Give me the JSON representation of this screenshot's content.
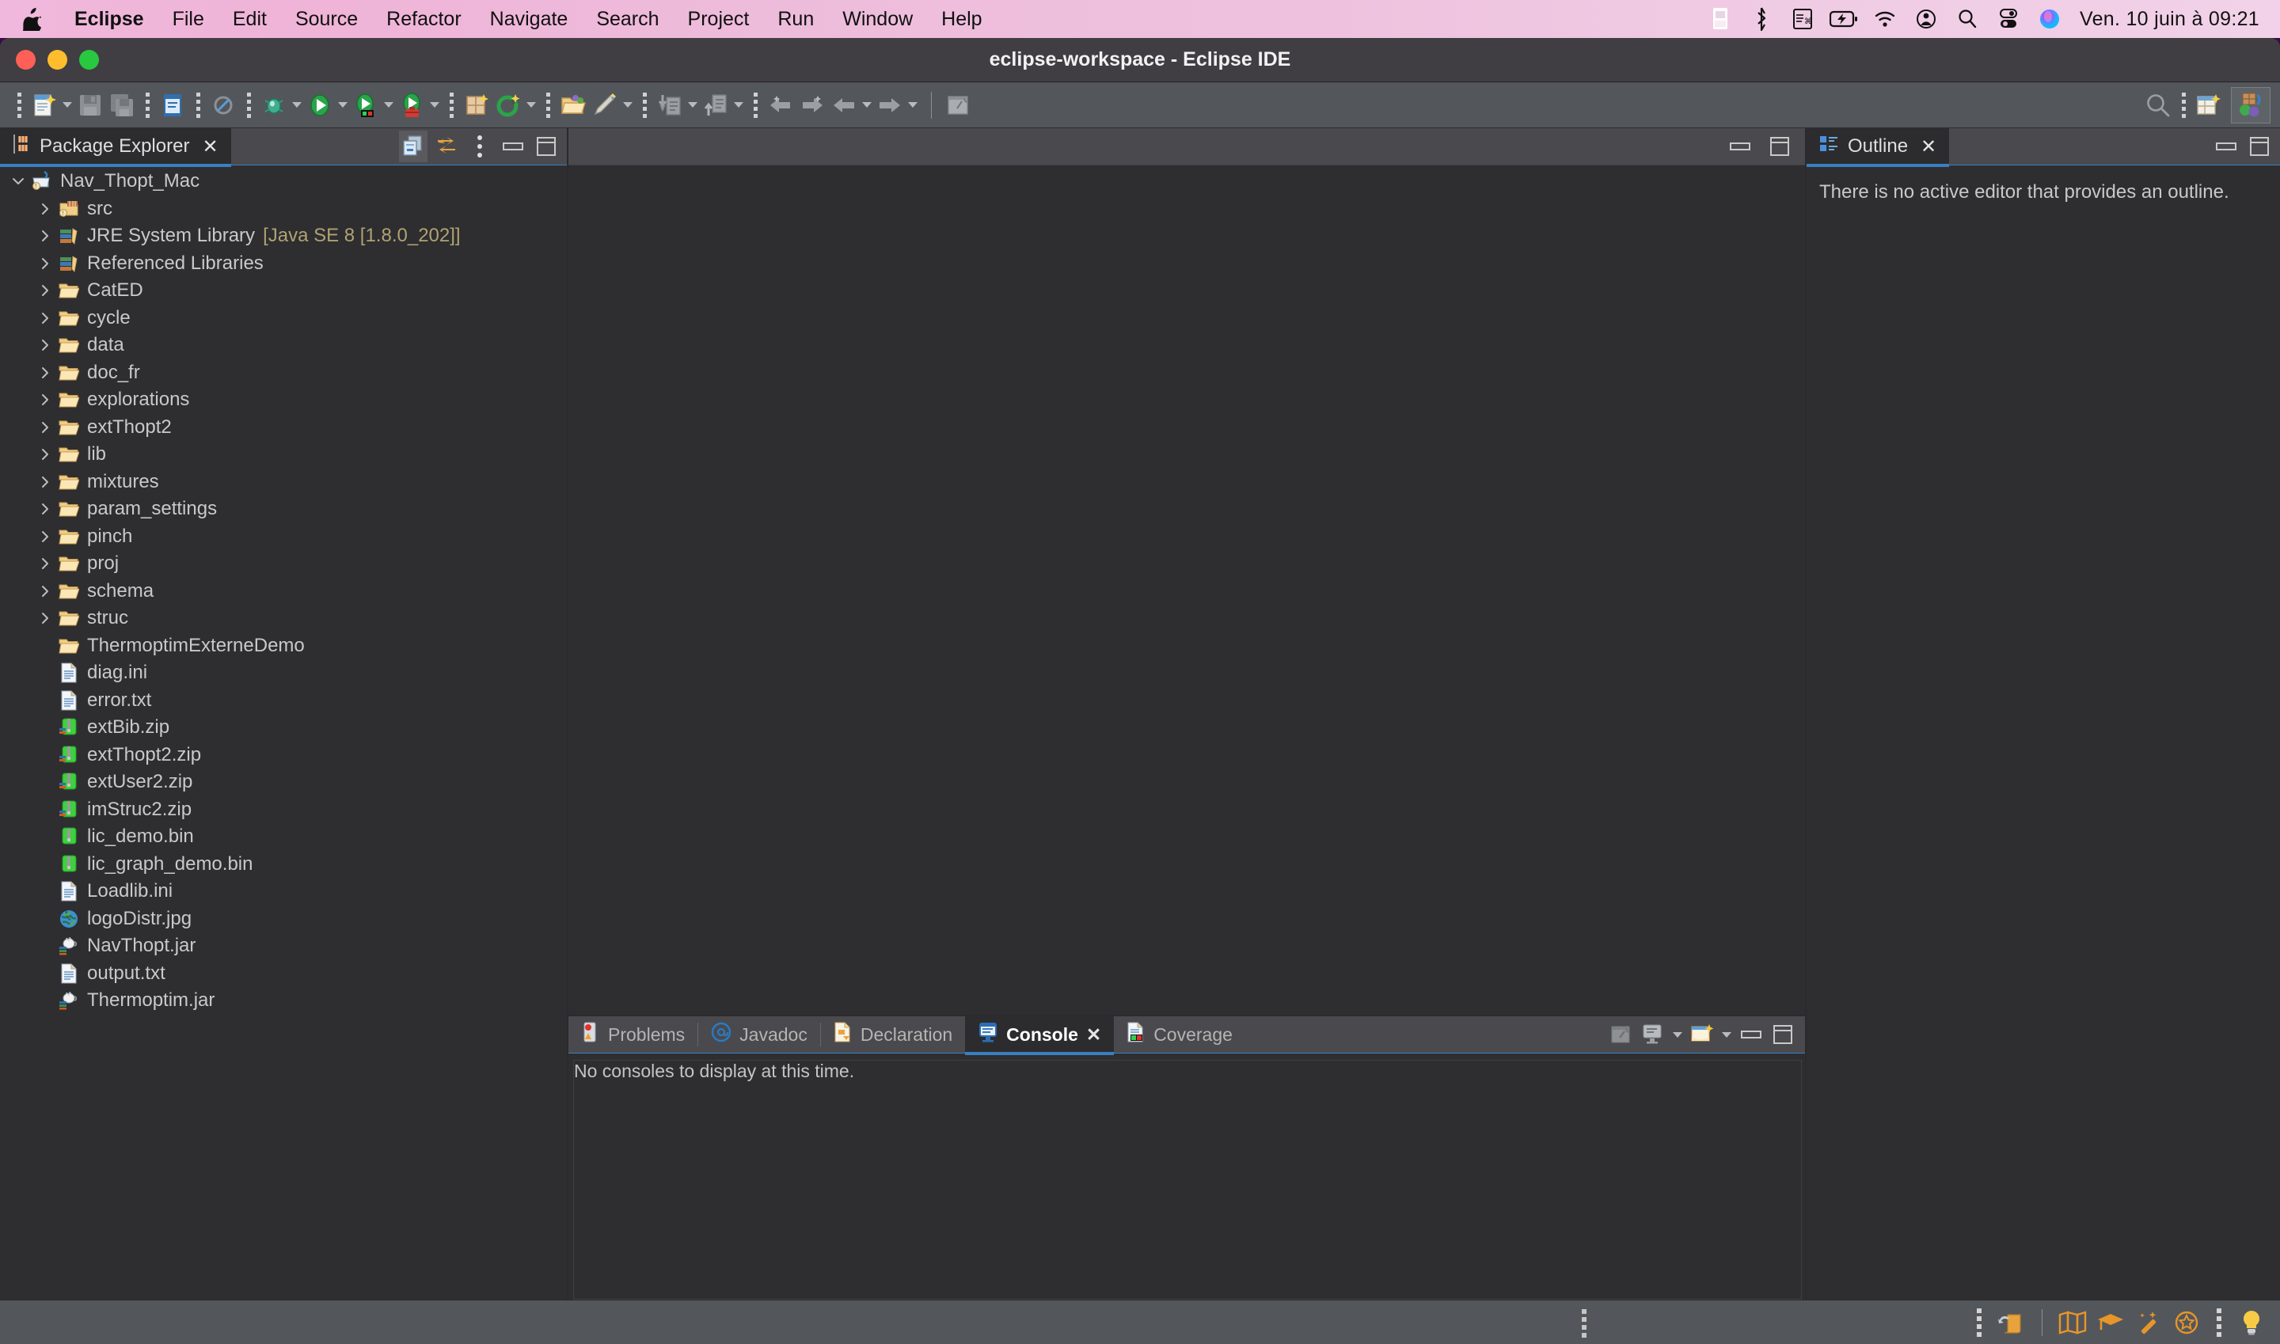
{
  "macbar": {
    "apple_icon": "apple-logo-icon",
    "menus": [
      {
        "label": "Eclipse",
        "bold": true
      },
      {
        "label": "File",
        "bold": false
      },
      {
        "label": "Edit",
        "bold": false
      },
      {
        "label": "Source",
        "bold": false
      },
      {
        "label": "Refactor",
        "bold": false
      },
      {
        "label": "Navigate",
        "bold": false
      },
      {
        "label": "Search",
        "bold": false
      },
      {
        "label": "Project",
        "bold": false
      },
      {
        "label": "Run",
        "bold": false
      },
      {
        "label": "Window",
        "bold": false
      },
      {
        "label": "Help",
        "bold": false
      }
    ],
    "status_icons": [
      "document-scanner-icon",
      "bluetooth-icon",
      "keyboard-input-icon",
      "battery-charging-icon",
      "wifi-icon",
      "user-account-icon",
      "spotlight-search-icon",
      "control-center-icon",
      "siri-icon"
    ],
    "clock": "Ven. 10 juin à  09:21"
  },
  "window": {
    "title": "eclipse-workspace - Eclipse IDE",
    "traffic_lights": [
      "close-button",
      "minimize-button",
      "zoom-button"
    ]
  },
  "toolbar": {
    "items": [
      {
        "name": "new-wizard-button",
        "icon": "new-file-icon",
        "dropdown": true
      },
      {
        "name": "save-button",
        "icon": "save-disk-icon",
        "dropdown": false
      },
      {
        "name": "save-all-button",
        "icon": "save-all-icon",
        "dropdown": false
      },
      {
        "name": "new-java-class-button",
        "icon": "java-class-icon",
        "dropdown": false
      },
      {
        "name": "skip-breakpoints-button",
        "icon": "skip-all-breakpoints-icon",
        "dropdown": false
      },
      {
        "name": "debug-button",
        "icon": "debug-bug-icon",
        "dropdown": true
      },
      {
        "name": "run-button",
        "icon": "run-green-play-icon",
        "dropdown": true
      },
      {
        "name": "coverage-button",
        "icon": "coverage-play-icon",
        "dropdown": true
      },
      {
        "name": "run-external-tools-button",
        "icon": "external-tools-toolbox-icon",
        "dropdown": true
      },
      {
        "name": "new-java-package-button",
        "icon": "new-package-icon",
        "dropdown": false
      },
      {
        "name": "new-class-wizard-button",
        "icon": "new-class-green-icon",
        "dropdown": true
      },
      {
        "name": "open-type-button",
        "icon": "open-folder-icon",
        "dropdown": false
      },
      {
        "name": "toggle-mark-occurrences-button",
        "icon": "highlighter-pen-icon",
        "dropdown": true
      },
      {
        "name": "import-button",
        "icon": "import-arrow-icon",
        "dropdown": true
      },
      {
        "name": "export-button",
        "icon": "export-arrow-icon",
        "dropdown": true
      },
      {
        "name": "previous-annotation-button",
        "icon": "previous-annotation-icon",
        "dropdown": false
      },
      {
        "name": "next-annotation-button",
        "icon": "next-annotation-icon",
        "dropdown": false
      },
      {
        "name": "back-button",
        "icon": "back-arrow-icon",
        "dropdown": true
      },
      {
        "name": "forward-button",
        "icon": "forward-arrow-icon",
        "dropdown": true
      },
      {
        "name": "pin-editor-button",
        "icon": "pin-editor-icon",
        "dropdown": false
      }
    ],
    "right_items": [
      {
        "name": "quick-access-search-button",
        "icon": "search-icon"
      },
      {
        "name": "open-perspective-button",
        "icon": "open-perspective-icon"
      },
      {
        "name": "java-perspective-button",
        "icon": "java-perspective-icon",
        "active": true
      }
    ]
  },
  "package_explorer": {
    "tab_label": "Package Explorer",
    "tab_icon": "package-explorer-icon",
    "close_label": "✕",
    "tools": [
      {
        "name": "collapse-all-button",
        "icon": "collapse-all-icon"
      },
      {
        "name": "link-with-editor-button",
        "icon": "link-with-editor-icon"
      },
      {
        "name": "view-menu-button",
        "icon": "view-menu-dots-icon"
      },
      {
        "name": "minimize-panel-button",
        "icon": "minimize-icon"
      },
      {
        "name": "maximize-panel-button",
        "icon": "maximize-icon"
      }
    ],
    "tree": [
      {
        "label": "Nav_Thopt_Mac",
        "icon": "java-project-icon",
        "indent": 0,
        "twisty": "down",
        "suffix": ""
      },
      {
        "label": "src",
        "icon": "source-folder-icon",
        "indent": 1,
        "twisty": "right",
        "suffix": ""
      },
      {
        "label": "JRE System Library",
        "icon": "library-icon",
        "indent": 1,
        "twisty": "right",
        "suffix": "[Java SE 8 [1.8.0_202]]"
      },
      {
        "label": "Referenced Libraries",
        "icon": "library-icon",
        "indent": 1,
        "twisty": "right",
        "suffix": ""
      },
      {
        "label": "CatED",
        "icon": "folder-icon",
        "indent": 1,
        "twisty": "right",
        "suffix": ""
      },
      {
        "label": "cycle",
        "icon": "folder-icon",
        "indent": 1,
        "twisty": "right",
        "suffix": ""
      },
      {
        "label": "data",
        "icon": "folder-icon",
        "indent": 1,
        "twisty": "right",
        "suffix": ""
      },
      {
        "label": "doc_fr",
        "icon": "folder-icon",
        "indent": 1,
        "twisty": "right",
        "suffix": ""
      },
      {
        "label": "explorations",
        "icon": "folder-icon",
        "indent": 1,
        "twisty": "right",
        "suffix": ""
      },
      {
        "label": "extThopt2",
        "icon": "folder-icon",
        "indent": 1,
        "twisty": "right",
        "suffix": ""
      },
      {
        "label": "lib",
        "icon": "folder-icon",
        "indent": 1,
        "twisty": "right",
        "suffix": ""
      },
      {
        "label": "mixtures",
        "icon": "folder-icon",
        "indent": 1,
        "twisty": "right",
        "suffix": ""
      },
      {
        "label": "param_settings",
        "icon": "folder-icon",
        "indent": 1,
        "twisty": "right",
        "suffix": ""
      },
      {
        "label": "pinch",
        "icon": "folder-icon",
        "indent": 1,
        "twisty": "right",
        "suffix": ""
      },
      {
        "label": "proj",
        "icon": "folder-icon",
        "indent": 1,
        "twisty": "right",
        "suffix": ""
      },
      {
        "label": "schema",
        "icon": "folder-icon",
        "indent": 1,
        "twisty": "right",
        "suffix": ""
      },
      {
        "label": "struc",
        "icon": "folder-icon",
        "indent": 1,
        "twisty": "right",
        "suffix": ""
      },
      {
        "label": "ThermoptimExterneDemo",
        "icon": "folder-icon",
        "indent": 1,
        "twisty": "none",
        "suffix": ""
      },
      {
        "label": "diag.ini",
        "icon": "text-file-icon",
        "indent": 1,
        "twisty": "none",
        "suffix": ""
      },
      {
        "label": "error.txt",
        "icon": "text-file-icon",
        "indent": 1,
        "twisty": "none",
        "suffix": ""
      },
      {
        "label": "extBib.zip",
        "icon": "zip-archive-icon",
        "indent": 1,
        "twisty": "none",
        "suffix": ""
      },
      {
        "label": "extThopt2.zip",
        "icon": "zip-archive-icon",
        "indent": 1,
        "twisty": "none",
        "suffix": ""
      },
      {
        "label": "extUser2.zip",
        "icon": "zip-archive-icon",
        "indent": 1,
        "twisty": "none",
        "suffix": ""
      },
      {
        "label": "imStruc2.zip",
        "icon": "zip-archive-icon",
        "indent": 1,
        "twisty": "none",
        "suffix": ""
      },
      {
        "label": "lic_demo.bin",
        "icon": "binary-file-icon",
        "indent": 1,
        "twisty": "none",
        "suffix": ""
      },
      {
        "label": "lic_graph_demo.bin",
        "icon": "binary-file-icon",
        "indent": 1,
        "twisty": "none",
        "suffix": ""
      },
      {
        "label": "Loadlib.ini",
        "icon": "text-file-icon",
        "indent": 1,
        "twisty": "none",
        "suffix": ""
      },
      {
        "label": "logoDistr.jpg",
        "icon": "image-globe-icon",
        "indent": 1,
        "twisty": "none",
        "suffix": ""
      },
      {
        "label": "NavThopt.jar",
        "icon": "jar-file-icon",
        "indent": 1,
        "twisty": "none",
        "suffix": ""
      },
      {
        "label": "output.txt",
        "icon": "text-file-icon",
        "indent": 1,
        "twisty": "none",
        "suffix": ""
      },
      {
        "label": "Thermoptim.jar",
        "icon": "jar-file-icon",
        "indent": 1,
        "twisty": "none",
        "suffix": ""
      }
    ]
  },
  "editor": {
    "tools": [
      {
        "name": "minimize-editor-button",
        "icon": "minimize-icon"
      },
      {
        "name": "maximize-editor-button",
        "icon": "maximize-icon"
      }
    ]
  },
  "outline": {
    "tab_label": "Outline",
    "tab_icon": "outline-icon",
    "close_label": "✕",
    "message": "There is no active editor that provides an outline.",
    "tools": [
      {
        "name": "minimize-outline-button",
        "icon": "minimize-icon"
      },
      {
        "name": "maximize-outline-button",
        "icon": "maximize-icon"
      }
    ]
  },
  "bottom_panel": {
    "tabs": [
      {
        "label": "Problems",
        "icon": "problems-icon",
        "active": false,
        "closable": false
      },
      {
        "label": "Javadoc",
        "icon": "javadoc-at-icon",
        "active": false,
        "closable": false
      },
      {
        "label": "Declaration",
        "icon": "declaration-icon",
        "active": false,
        "closable": false
      },
      {
        "label": "Console",
        "icon": "console-icon",
        "active": true,
        "closable": true
      },
      {
        "label": "Coverage",
        "icon": "coverage-icon",
        "active": false,
        "closable": false
      }
    ],
    "close_label": "✕",
    "tools": [
      {
        "name": "pin-console-button",
        "icon": "pin-console-icon",
        "dropdown": false
      },
      {
        "name": "display-selected-console-button",
        "icon": "display-console-icon",
        "dropdown": true
      },
      {
        "name": "open-console-button",
        "icon": "open-console-icon",
        "dropdown": true
      },
      {
        "name": "minimize-console-button",
        "icon": "minimize-icon",
        "dropdown": false
      },
      {
        "name": "maximize-console-button",
        "icon": "maximize-icon",
        "dropdown": false
      }
    ],
    "console_message": "No consoles to display at this time."
  },
  "statusbar": {
    "right_icons": [
      {
        "name": "drag-handle",
        "icon": "drag-dots-icon"
      },
      {
        "name": "undo-history-button",
        "icon": "undo-scroll-icon"
      },
      {
        "name": "map-button",
        "icon": "map-icon"
      },
      {
        "name": "tutorial-button",
        "icon": "graduation-cap-icon"
      },
      {
        "name": "magic-wand-button",
        "icon": "magic-wand-icon"
      },
      {
        "name": "star-badge-button",
        "icon": "star-badge-icon"
      },
      {
        "name": "drag-handle-2",
        "icon": "drag-dots-icon"
      },
      {
        "name": "tip-lightbulb-button",
        "icon": "lightbulb-icon"
      }
    ]
  },
  "colors": {
    "accent_blue": "#3a7fc1",
    "tree_bg": "#2e2e30",
    "panel_bg": "#434247",
    "toolbar_bg": "#53575b",
    "suffix_olive": "#b0a273",
    "menu_pink": "#eebcdb"
  }
}
